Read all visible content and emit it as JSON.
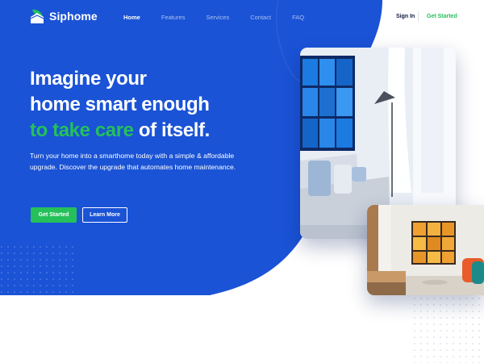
{
  "brand": {
    "name": "Siphome",
    "logo_icon": "leaf-house-icon"
  },
  "nav": {
    "items": [
      {
        "label": "Home",
        "active": true
      },
      {
        "label": "Features",
        "active": false
      },
      {
        "label": "Services",
        "active": false
      },
      {
        "label": "Contact",
        "active": false
      },
      {
        "label": "FAQ",
        "active": false
      }
    ],
    "signin_label": "Sign In",
    "get_started_label": "Get Started"
  },
  "hero": {
    "headline_line1": "Imagine your",
    "headline_line2": "home smart enough",
    "headline_line3_highlight": "to take care",
    "headline_line3_rest": "of itself.",
    "subtext": "Turn your home into a smarthome today with a simple & affordable upgrade. Discover the upgrade that automates home maintenance.",
    "primary_button": "Get Started",
    "secondary_button": "Learn More"
  },
  "images": [
    {
      "name": "living-room-photo",
      "description": "bright living room with blue wall art and floor lamp"
    },
    {
      "name": "interior-photo",
      "description": "modern interior with orange wall art and cabinet"
    }
  ],
  "colors": {
    "hero_blue": "#1a53d6",
    "accent_green": "#25c05a",
    "text_dark": "#0f1b3d",
    "background": "#ffffff"
  }
}
